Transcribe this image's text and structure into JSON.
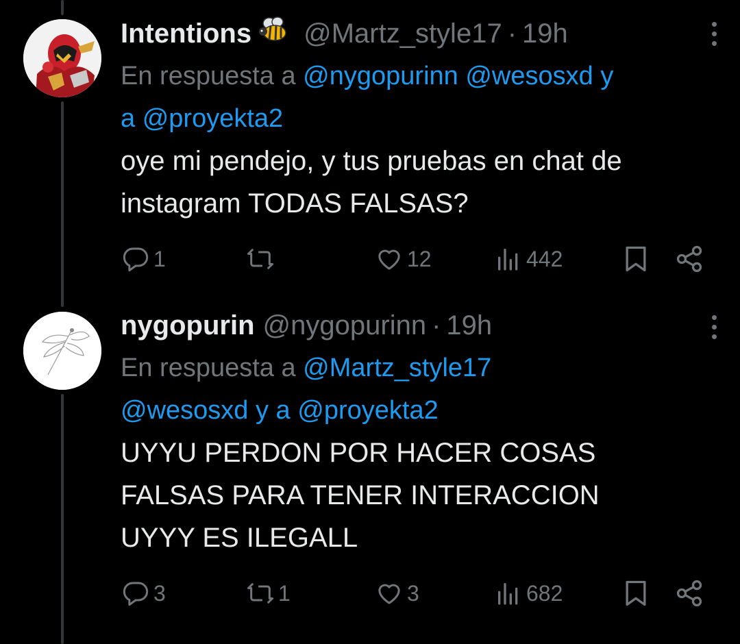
{
  "colors": {
    "background": "#000000",
    "text": "#e7e9ea",
    "muted": "#71767b",
    "link": "#1d9bf0",
    "thread_line": "#333639"
  },
  "tweets": [
    {
      "display_name": "Intentions",
      "emoji": "bee-icon",
      "handle": "@Martz_style17",
      "dot": "·",
      "time": "19h",
      "reply_prefix": "En respuesta a",
      "reply_mentions_line1": [
        "@nygopurinn",
        "@wesosxd"
      ],
      "reply_joiner": "y",
      "reply_line2_prefix": "a",
      "reply_mention_last": "@proyekta2",
      "body_lines": [
        "oye mi pendejo, y tus pruebas en chat de",
        "instagram TODAS FALSAS?"
      ],
      "stats": {
        "replies": "1",
        "retweets": "",
        "likes": "12",
        "views": "442"
      }
    },
    {
      "display_name": "nygopurin",
      "handle": "@nygopurinn",
      "dot": "·",
      "time": "19h",
      "reply_prefix": "En respuesta a",
      "reply_mention_first": "@Martz_style17",
      "reply_mention_second": "@wesosxd",
      "reply_joiner": "y",
      "reply_line2_prefix": "a",
      "reply_mention_last": "@proyekta2",
      "body_lines": [
        "UYYU PERDON POR HACER COSAS",
        "FALSAS PARA TENER INTERACCION",
        "UYYY ES ILEGALL"
      ],
      "stats": {
        "replies": "3",
        "retweets": "1",
        "likes": "3",
        "views": "682"
      }
    }
  ]
}
